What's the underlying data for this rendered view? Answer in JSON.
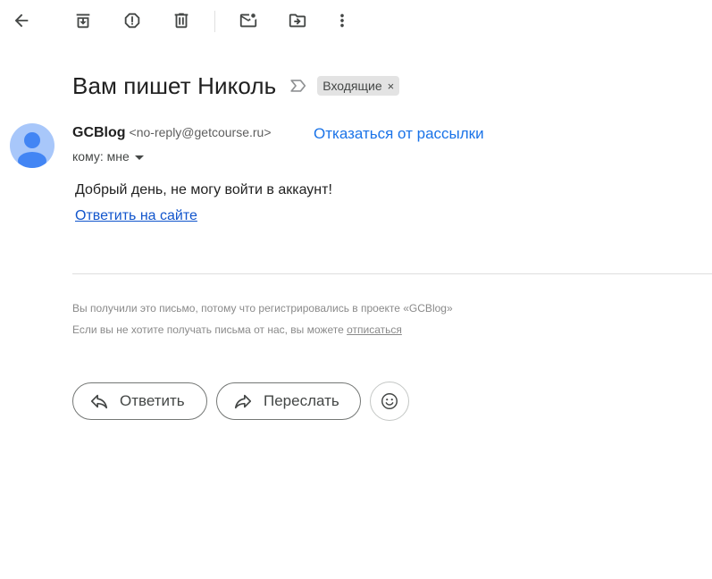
{
  "toolbar": {
    "icons": [
      "back-arrow-icon",
      "archive-icon",
      "report-spam-icon",
      "delete-icon",
      "mark-unread-icon",
      "move-to-icon",
      "more-vert-icon"
    ]
  },
  "message": {
    "subject": "Вам пишет Николь",
    "label": "Входящие",
    "label_remove": "×",
    "sender_name": "GCBlog",
    "sender_email": "<no-reply@getcourse.ru>",
    "unsubscribe": "Отказаться от рассылки",
    "to": "кому: мне",
    "body_text": "Добрый день, не могу войти в аккаунт!",
    "reply_link": "Ответить на сайте",
    "footer_line1": "Вы получили это письмо, потому что регистрировались в проекте «GCBlog»",
    "footer_line2_prefix": "Если вы не хотите получать письма от нас, вы можете ",
    "footer_line2_link": "отписаться"
  },
  "actions": {
    "reply": "Ответить",
    "forward": "Переслать"
  },
  "colors": {
    "accent": "#1a73e8",
    "link": "#1155cc",
    "avatar_bg": "#a8c7fa",
    "avatar_fg": "#4285f4",
    "chip_bg": "#e3e3e3"
  }
}
